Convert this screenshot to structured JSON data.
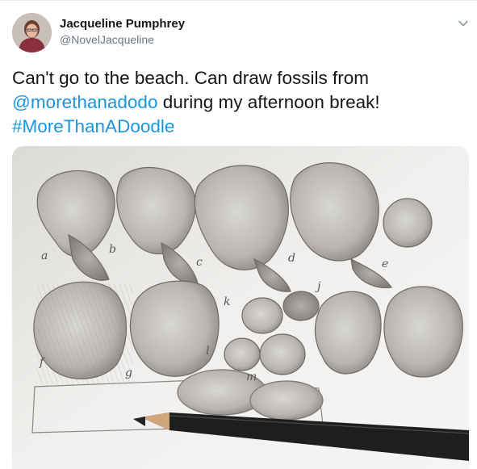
{
  "tweet": {
    "author_name": "Jacqueline Pumphrey",
    "author_handle": "@NovelJacqueline",
    "text_line1": "Can't go to the beach. Can draw fossils from",
    "mention": "@morethanadodo",
    "text_line2_rest": " during my afternoon break!",
    "hashtag": "#MoreThanADoodle"
  },
  "icons": {
    "menu": "chevron-down-icon",
    "avatar": "avatar",
    "media": "fossil-sketch-photo"
  },
  "colors": {
    "link": "#1b95e0",
    "text": "#14171a",
    "muted": "#657786"
  },
  "sketch_labels": [
    "a",
    "b",
    "c",
    "d",
    "j",
    "e",
    "k",
    "f",
    "g",
    "l",
    "m"
  ]
}
